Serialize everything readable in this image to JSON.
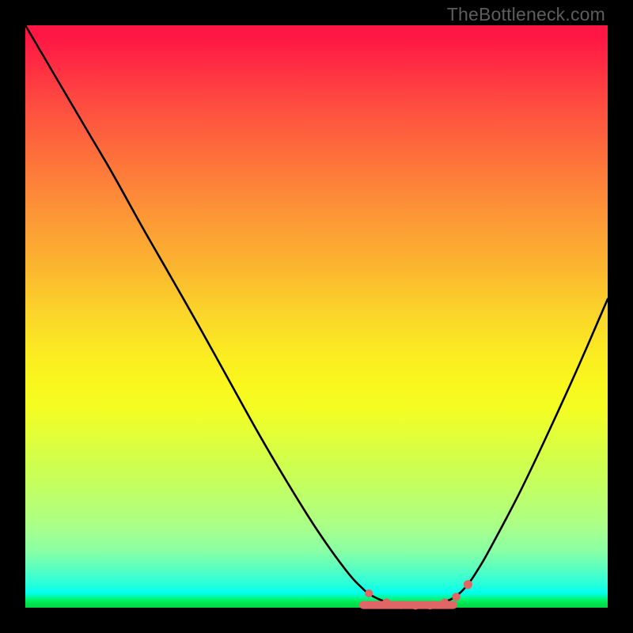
{
  "attribution": "TheBottleneck.com",
  "colors": {
    "frame": "#000000",
    "curve": "#000000",
    "dot_fill": "#E06666",
    "dot_stroke": "#CC5555",
    "gradient_top": "#FE1745",
    "gradient_bottom": "#00D644"
  },
  "chart_data": {
    "type": "line",
    "title": "",
    "xlabel": "",
    "ylabel": "",
    "xlim": [
      0,
      100
    ],
    "ylim": [
      0,
      100
    ],
    "x": [
      0,
      5,
      10,
      15,
      20,
      25,
      30,
      35,
      40,
      45,
      50,
      55,
      58,
      60,
      62,
      65,
      68,
      70,
      72,
      74,
      76,
      78,
      80,
      85,
      90,
      95,
      100
    ],
    "y": [
      100,
      91.5,
      83,
      74.5,
      65.5,
      56.8,
      48,
      39,
      30,
      21.5,
      13.5,
      6.5,
      3.2,
      1.8,
      1.0,
      0.5,
      0.5,
      0.6,
      1.0,
      2.0,
      4.0,
      7.0,
      10.5,
      20,
      30.5,
      41.5,
      53
    ],
    "optimal_segment": {
      "xstart": 58,
      "xend": 76,
      "dots_x": [
        59,
        62,
        64.5,
        67,
        69.5,
        72,
        74,
        76
      ],
      "dots_y": [
        2.6,
        1.0,
        0.6,
        0.5,
        0.55,
        1.0,
        2.0,
        4.0
      ]
    }
  }
}
